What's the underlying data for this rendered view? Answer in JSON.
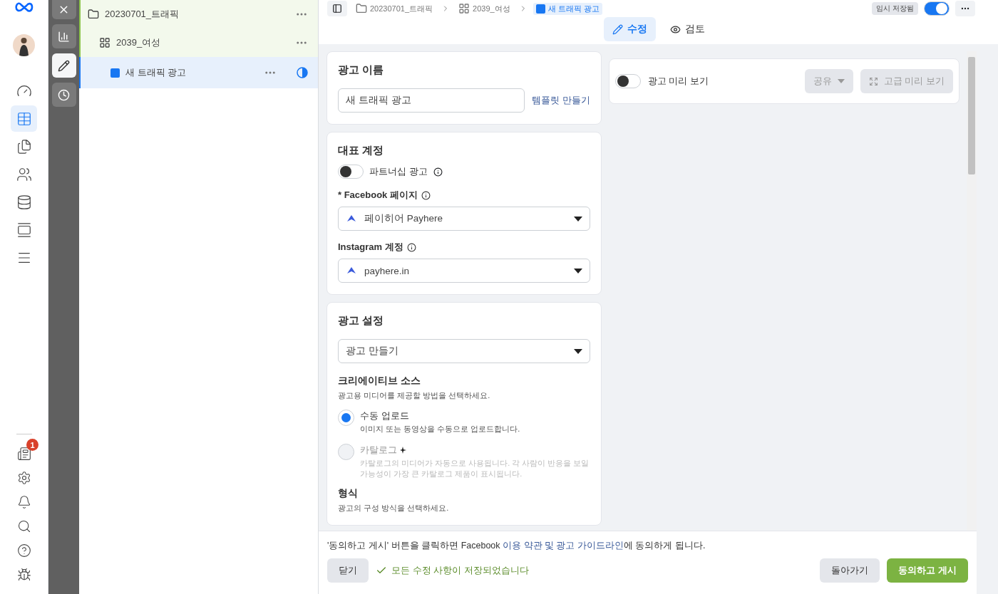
{
  "tree": [
    {
      "kind": "campaign",
      "label": "20230701_트래픽",
      "selected": false
    },
    {
      "kind": "adset",
      "label": "2039_여성",
      "selected": false
    },
    {
      "kind": "ad",
      "label": "새 트래픽 광고",
      "selected": true
    }
  ],
  "tools": [
    {
      "kind": "close",
      "selected": false
    },
    {
      "kind": "chart",
      "selected": false
    },
    {
      "kind": "edit",
      "selected": true
    },
    {
      "kind": "history",
      "selected": false
    }
  ],
  "nav": [
    {
      "kind": "dashboard",
      "selected": false
    },
    {
      "kind": "table",
      "selected": true
    },
    {
      "kind": "pages",
      "selected": false
    },
    {
      "kind": "audience",
      "selected": false
    },
    {
      "kind": "database",
      "selected": false
    },
    {
      "kind": "catalog",
      "selected": false
    },
    {
      "kind": "menu",
      "selected": false
    }
  ],
  "nav_bottom": [
    {
      "kind": "news",
      "badge": "1"
    },
    {
      "kind": "settings"
    },
    {
      "kind": "bell"
    },
    {
      "kind": "search"
    },
    {
      "kind": "help"
    },
    {
      "kind": "bug"
    }
  ],
  "breadcrumb": [
    {
      "kind": "campaign",
      "label": "20230701_트래픽",
      "selected": false
    },
    {
      "kind": "adset",
      "label": "2039_여성",
      "selected": false
    },
    {
      "kind": "ad",
      "label": "새 트래픽 광고",
      "selected": true
    }
  ],
  "status_badge": "임시 저장됨",
  "publish_toggle": {
    "on": true
  },
  "mode_tabs": [
    {
      "kind": "edit",
      "label": "수정",
      "selected": true
    },
    {
      "kind": "review",
      "label": "검토",
      "selected": false
    }
  ],
  "ad_name": {
    "title": "광고 이름",
    "value": "새 트래픽 광고",
    "link": "템플릿 만들기"
  },
  "identity": {
    "title": "대표 계정",
    "partnership": {
      "label": "파트너십 광고",
      "on": false
    },
    "facebook_page": {
      "label": "* Facebook 페이지",
      "value": "페이히어 Payhere"
    },
    "instagram": {
      "label": "Instagram 계정",
      "value": "payhere.in"
    }
  },
  "ad_setup": {
    "title": "광고 설정",
    "select": "광고 만들기",
    "source_title": "크리에이티브 소스",
    "source_hint": "광고용 미디어를 제공할 방법을 선택하세요.",
    "options": [
      {
        "label": "수동 업로드",
        "hint": "이미지 또는 동영상을 수동으로 업로드합니다.",
        "selected": true,
        "disabled": false,
        "sparkle": false
      },
      {
        "label": "카탈로그",
        "hint": "카탈로그의 미디어가 자동으로 사용됩니다. 각 사람이 반응을 보일 가능성이 가장 큰 카탈로그 제품이 표시됩니다.",
        "selected": false,
        "disabled": true,
        "sparkle": true
      }
    ],
    "format_title": "형식",
    "format_hint": "광고의 구성 방식을 선택하세요."
  },
  "preview": {
    "toggle": {
      "label": "광고 미리 보기",
      "on": false
    },
    "share": "공유",
    "advanced": "고급 미리 보기"
  },
  "footer": {
    "notice_before": "'동의하고 게시' 버튼을 클릭하면 Facebook ",
    "notice_link": "이용 약관 및 광고 가이드라인",
    "notice_after": "에 동의하게 됩니다.",
    "close": "닫기",
    "saved": "모든 수정 사항이 저장되었습니다",
    "back": "돌아가기",
    "publish": "동의하고 게시"
  }
}
